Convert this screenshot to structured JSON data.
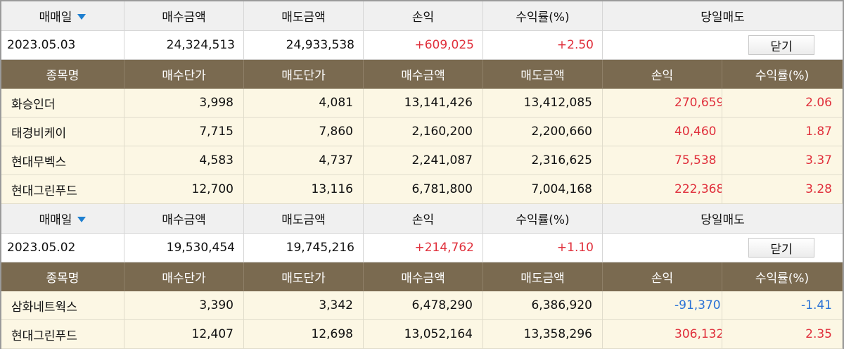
{
  "header_labels": {
    "trade_date": "매매일",
    "buy_amount": "매수금액",
    "sell_amount": "매도금액",
    "profit": "손익",
    "return_rate": "수익률(%)",
    "same_day_sell": "당일매도"
  },
  "item_header_labels": {
    "name": "종목명",
    "buy_price": "매수단가",
    "sell_price": "매도단가",
    "buy_amount": "매수금액",
    "sell_amount": "매도금액",
    "profit": "손익",
    "return_rate": "수익률(%)"
  },
  "close_label": "닫기",
  "colors": {
    "positive": "#e0303c",
    "negative": "#2a72d6",
    "item_header_bg": "#7a6a50",
    "item_bg": "#fcf7e4",
    "sort_arrow": "#1e7fd0"
  },
  "groups": [
    {
      "summary": {
        "date": "2023.05.03",
        "buy_amount": "24,324,513",
        "sell_amount": "24,933,538",
        "profit": "+609,025",
        "return_rate": "+2.50"
      },
      "items": [
        {
          "name": "화승인더",
          "buy_price": "3,998",
          "sell_price": "4,081",
          "buy_amount": "13,141,426",
          "sell_amount": "13,412,085",
          "profit": "270,659",
          "return_rate": "2.06"
        },
        {
          "name": "태경비케이",
          "buy_price": "7,715",
          "sell_price": "7,860",
          "buy_amount": "2,160,200",
          "sell_amount": "2,200,660",
          "profit": "40,460",
          "return_rate": "1.87"
        },
        {
          "name": "현대무벡스",
          "buy_price": "4,583",
          "sell_price": "4,737",
          "buy_amount": "2,241,087",
          "sell_amount": "2,316,625",
          "profit": "75,538",
          "return_rate": "3.37"
        },
        {
          "name": "현대그린푸드",
          "buy_price": "12,700",
          "sell_price": "13,116",
          "buy_amount": "6,781,800",
          "sell_amount": "7,004,168",
          "profit": "222,368",
          "return_rate": "3.28"
        }
      ]
    },
    {
      "summary": {
        "date": "2023.05.02",
        "buy_amount": "19,530,454",
        "sell_amount": "19,745,216",
        "profit": "+214,762",
        "return_rate": "+1.10"
      },
      "items": [
        {
          "name": "삼화네트웍스",
          "buy_price": "3,390",
          "sell_price": "3,342",
          "buy_amount": "6,478,290",
          "sell_amount": "6,386,920",
          "profit": "-91,370",
          "return_rate": "-1.41"
        },
        {
          "name": "현대그린푸드",
          "buy_price": "12,407",
          "sell_price": "12,698",
          "buy_amount": "13,052,164",
          "sell_amount": "13,358,296",
          "profit": "306,132",
          "return_rate": "2.35"
        }
      ]
    }
  ]
}
